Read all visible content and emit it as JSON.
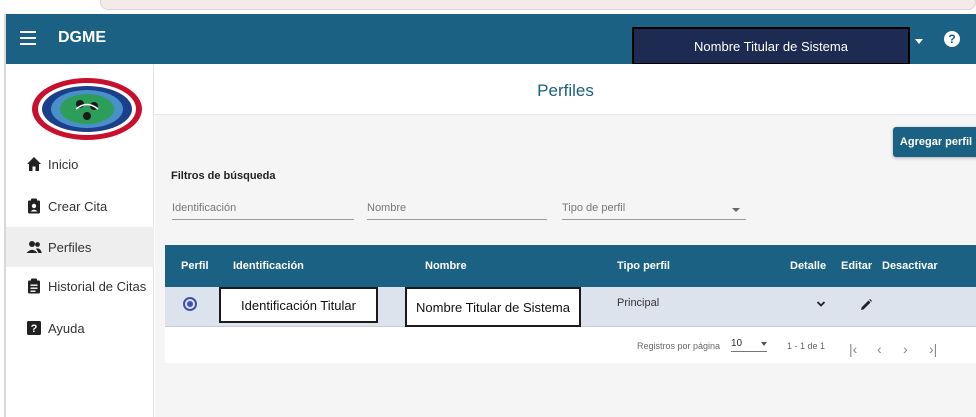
{
  "app": {
    "title": "DGME"
  },
  "header": {
    "user_name": "Nombre Titular de Sistema"
  },
  "sidebar": {
    "items": [
      {
        "label": "Inicio",
        "icon": "home-icon"
      },
      {
        "label": "Crear Cita",
        "icon": "clipboard-icon"
      },
      {
        "label": "Perfiles",
        "icon": "users-icon",
        "active": true
      },
      {
        "label": "Historial de Citas",
        "icon": "clipboard-list-icon"
      },
      {
        "label": "Ayuda",
        "icon": "question-square-icon"
      }
    ]
  },
  "page": {
    "title": "Perfiles",
    "add_button": "Agregar perfil",
    "filters_label": "Filtros de búsqueda",
    "filters": {
      "identificacion_placeholder": "Identificación",
      "nombre_placeholder": "Nombre",
      "tipo_placeholder": "Tipo de perfil"
    }
  },
  "table": {
    "columns": [
      "Perfil",
      "Identificación",
      "Nombre",
      "Tipo perfil",
      "Detalle",
      "Editar",
      "Desactivar"
    ],
    "rows": [
      {
        "identificacion": "Identificación Titular",
        "nombre": "Nombre Titular de Sistema",
        "tipo": "Principal",
        "selected": true
      }
    ]
  },
  "pagination": {
    "rows_per_page_label": "Registros por página",
    "rows_per_page": "10",
    "range": "1 - 1 de 1"
  },
  "colors": {
    "primary": "#1a6183",
    "user_box": "#1d2b52",
    "row_bg": "#dce3ec"
  }
}
